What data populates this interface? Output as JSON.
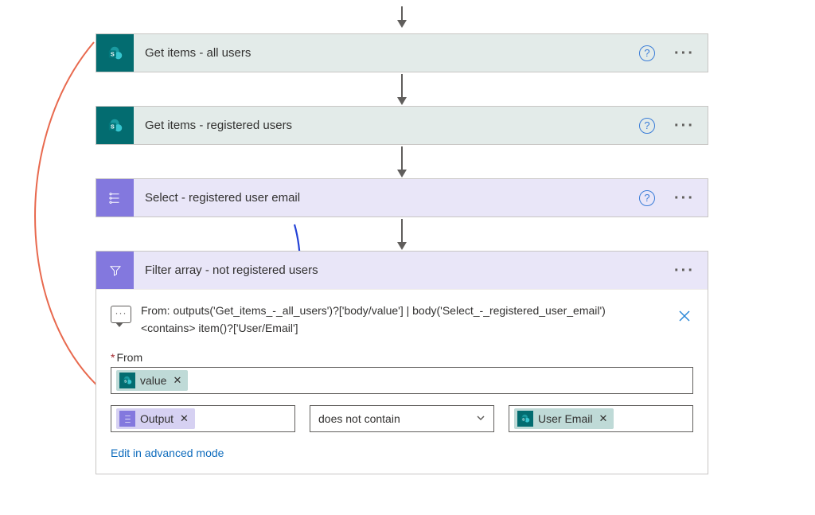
{
  "cards": {
    "c1": {
      "title": "Get items - all users"
    },
    "c2": {
      "title": "Get items - registered users"
    },
    "c3": {
      "title": "Select - registered user email"
    },
    "c4": {
      "title": "Filter array - not registered users",
      "comment_line1": "From: outputs('Get_items_-_all_users')?['body/value'] | body('Select_-_registered_user_email')",
      "comment_line2": "<contains> item()?['User/Email']",
      "from_label": "From",
      "token_value": "value",
      "token_output": "Output",
      "operator": "does not contain",
      "token_user_email": "User Email",
      "advanced_link": "Edit in advanced mode"
    }
  }
}
